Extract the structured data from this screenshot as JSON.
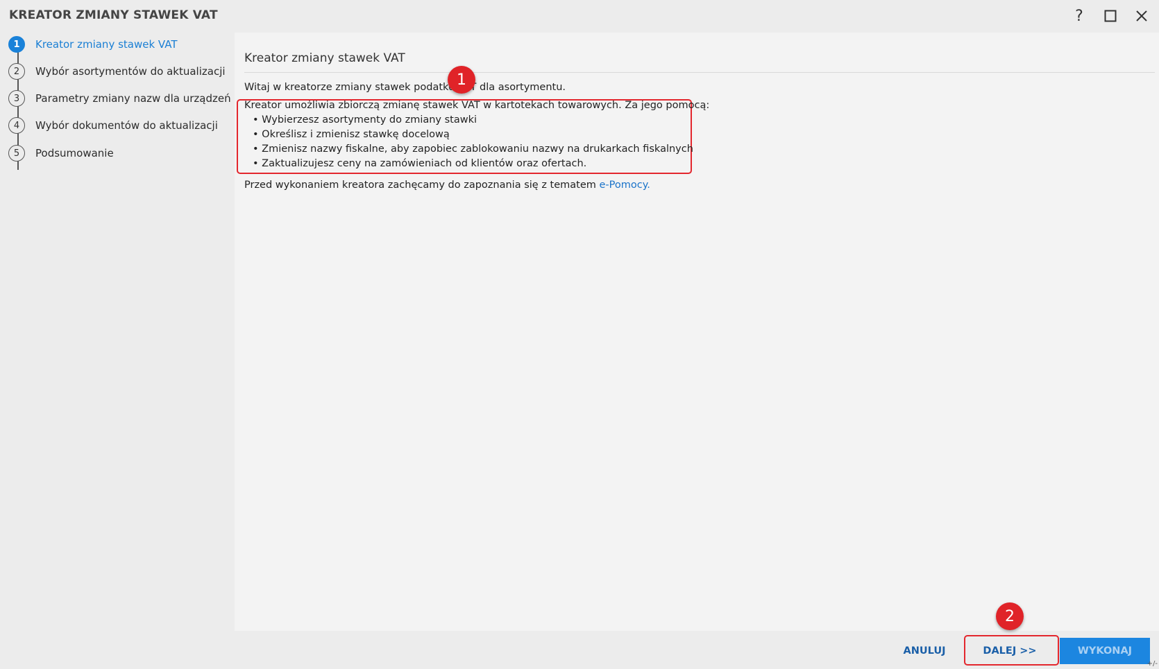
{
  "window": {
    "title": "KREATOR ZMIANY STAWEK VAT",
    "help_glyph": "?"
  },
  "steps": [
    {
      "number": "1",
      "label": "Kreator zmiany stawek VAT",
      "active": true
    },
    {
      "number": "2",
      "label": "Wybór asortymentów do aktualizacji",
      "active": false
    },
    {
      "number": "3",
      "label": "Parametry zmiany nazw dla urządzeń",
      "active": false
    },
    {
      "number": "4",
      "label": "Wybór dokumentów do aktualizacji",
      "active": false
    },
    {
      "number": "5",
      "label": "Podsumowanie",
      "active": false
    }
  ],
  "content": {
    "heading": "Kreator zmiany stawek VAT",
    "welcome": "Witaj w kreatorze zmiany stawek podatku VAT dla asortymentu.",
    "intro": "Kreator umożliwia zbiorczą zmianę stawek VAT w kartotekach towarowych. Za jego pomocą:",
    "bullets": [
      "• Wybierzesz asortymenty do zmiany stawki",
      "• Określisz i zmienisz stawkę docelową",
      "• Zmienisz nazwy fiskalne, aby zapobiec zablokowaniu nazwy na drukarkach fiskalnych",
      "• Zaktualizujesz ceny na zamówieniach od klientów oraz ofertach."
    ],
    "help_prefix": "Przed wykonaniem kreatora zachęcamy do zapoznania się z tematem ",
    "help_link": "e-Pomocy."
  },
  "annotations": {
    "marker_1": "1",
    "marker_2": "2"
  },
  "footer": {
    "cancel_label": "ANULUJ",
    "next_label": "DALEJ >>",
    "execute_label": "WYKONAJ",
    "resize_glyph": "+/-"
  },
  "colors": {
    "accent": "#1a82d9",
    "annotation_red": "#e3262d",
    "execute_button": "#1c86e0"
  }
}
